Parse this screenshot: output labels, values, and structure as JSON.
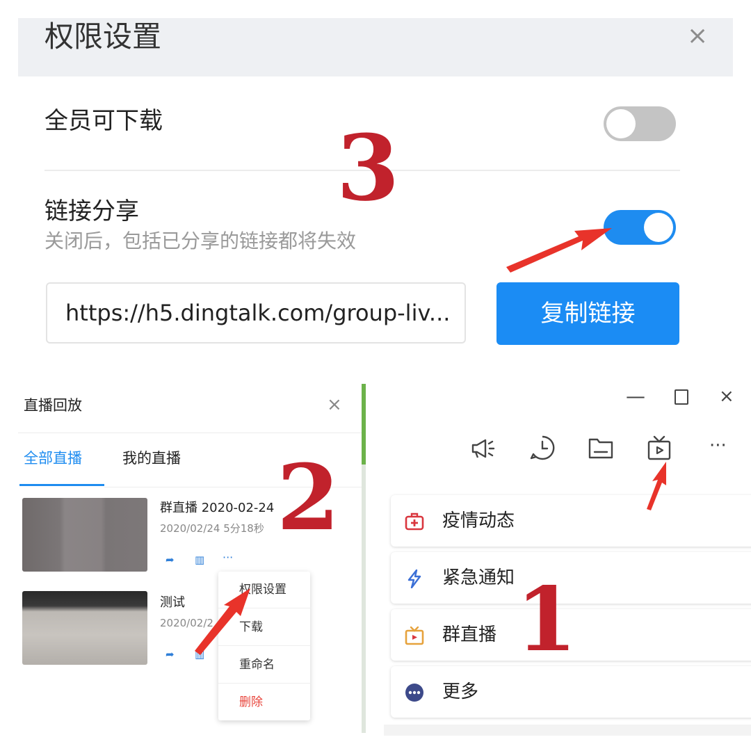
{
  "permission_dialog": {
    "title": "权限设置",
    "close": "×",
    "all_download_label": "全员可下载",
    "all_download_enabled": false,
    "link_share_label": "链接分享",
    "link_share_description": "关闭后，包括已分享的链接都将失效",
    "link_share_enabled": true,
    "link_value": "https://h5.dingtalk.com/group-liv...",
    "copy_link_button": "复制链接"
  },
  "replay_panel": {
    "title": "直播回放",
    "close": "×",
    "tabs": [
      "全部直播",
      "我的直播"
    ],
    "active_tab": "全部直播",
    "recordings": [
      {
        "title": "群直播 2020-02-24",
        "meta": "2020/02/24 5分18秒"
      },
      {
        "title": "测试",
        "meta": "2020/02/2"
      }
    ],
    "more_actions": "···",
    "context_menu": [
      "权限设置",
      "下载",
      "重命名",
      "删除"
    ]
  },
  "chat_window": {
    "window_controls": {
      "minimize": "—",
      "close": "×"
    },
    "toolbar_more": "···",
    "menu_items": [
      {
        "label": "疫情动态",
        "icon": "medkit-icon",
        "color": "#d9363e"
      },
      {
        "label": "紧急通知",
        "icon": "lightning-icon",
        "color": "#3b6fd6"
      },
      {
        "label": "群直播",
        "icon": "tv-icon",
        "color": "#e6a23c"
      },
      {
        "label": "更多",
        "icon": "more-circle-icon",
        "color": "#3d4a8a"
      }
    ]
  },
  "annotations": {
    "step1": "1",
    "step2": "2",
    "step3": "3"
  },
  "colors": {
    "accent": "#1e8cf0",
    "annotation": "#c1222c",
    "danger": "#e8453c"
  }
}
